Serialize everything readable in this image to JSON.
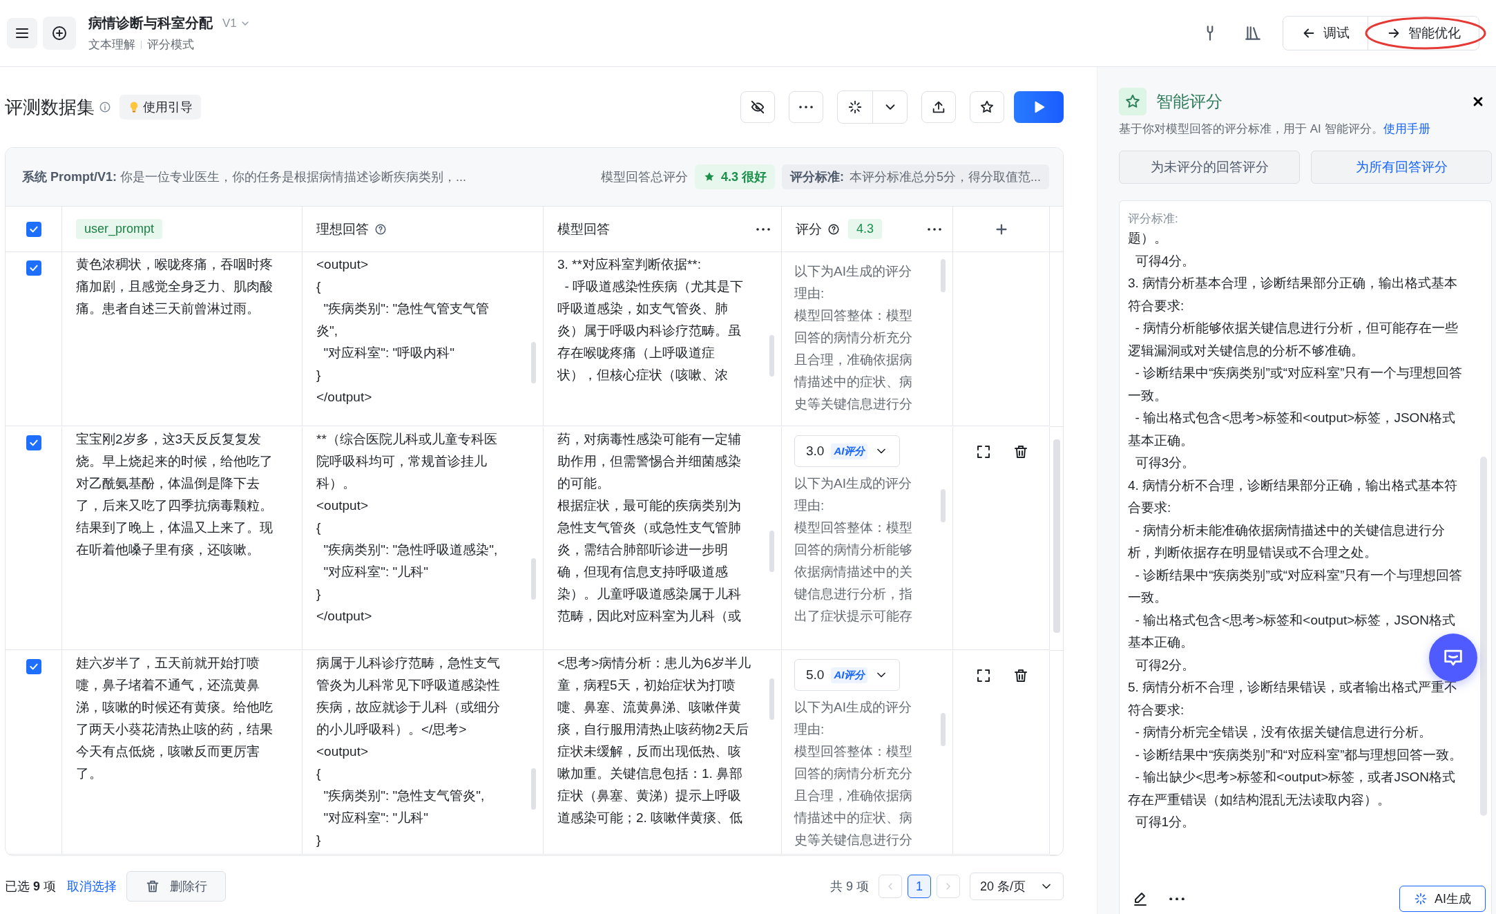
{
  "header": {
    "title": "病情诊断与科室分配",
    "version": "V1",
    "breadcrumb": [
      "文本理解",
      "评分模式"
    ],
    "buttons": [
      {
        "label": "调试",
        "kind": "back",
        "highlighted": false
      },
      {
        "label": "智能优化",
        "kind": "forward",
        "highlighted": true
      }
    ]
  },
  "toolbar": {
    "title": "评测数据集",
    "guide": "使用引导"
  },
  "prompt_bar": {
    "label": "系统 Prompt/V1:",
    "text": "你是一位专业医生，你的任务是根据病情描述诊断疾病类别，...",
    "total_label": "模型回答总评分",
    "total_score": "4.3 很好",
    "criteria_label": "评分标准:",
    "criteria_text": "本评分标准总分5分，得分取值范..."
  },
  "table": {
    "all_checked": true,
    "columns": [
      {
        "label": "user_prompt",
        "kind": "tag"
      },
      {
        "label": "理想回答",
        "kind": "help"
      },
      {
        "label": "模型回答",
        "kind": "more"
      },
      {
        "label": "评分",
        "kind": "score",
        "badge": "4.3"
      }
    ],
    "rows": [
      {
        "checked": true,
        "user_prompt": "黄色浓稠状，喉咙疼痛，吞咽时疼痛加剧，且感觉全身乏力、肌肉酸痛。患者自述三天前曾淋过雨。",
        "ideal": [
          "<output>",
          "{",
          "  \"疾病类别\": \"急性气管支气管炎\",",
          "  \"对应科室\": \"呼吸内科\"",
          "}",
          "</output>"
        ],
        "model": [
          "3. **对应科室判断依据**:",
          "  - 呼吸道感染性疾病（尤其是下呼吸道感染，如支气管炎、肺炎）属于呼吸内科诊疗范畴。虽存在喉咙疼痛（上呼吸道症状），但核心症状（咳嗽、浓"
        ],
        "reason": [
          "以下为AI生成的评分理由:",
          "模型回答整体：模型回答的病情分析充分且合理，准确依据病情描述中的症状、病史等关键信息进行分"
        ],
        "actions": false
      },
      {
        "checked": true,
        "user_prompt": "宝宝刚2岁多，这3天反反复复发烧。早上烧起来的时候，给他吃了对乙酰氨基酚，体温倒是降下去了，后来又吃了四季抗病毒颗粒。结果到了晚上，体温又上来了。现在听着他嗓子里有痰，还咳嗽。",
        "ideal": [
          "**（综合医院儿科或儿童专科医院呼吸科均可，常规首诊挂儿科）。",
          "<output>",
          "{",
          "  \"疾病类别\": \"急性呼吸道感染\",",
          "  \"对应科室\": \"儿科\"",
          "}",
          "</output>"
        ],
        "model": [
          "药，对病毒性感染可能有一定辅助作用，但需警惕合并细菌感染的可能。",
          "根据症状，最可能的疾病类别为急性支气管炎（或急性支气管肺炎，需结合肺部听诊进一步明确，但现有信息支持呼吸道感染）。儿童呼吸道感染属于儿科范畴，因此对应科室为儿科（或"
        ],
        "score": "3.0",
        "score_tag": "AI评分",
        "reason": [
          "以下为AI生成的评分理由:",
          "模型回答整体：模型回答的病情分析能够依据病情描述中的关键信息进行分析，指出了症状提示可能存"
        ],
        "actions": true
      },
      {
        "checked": true,
        "user_prompt": "娃六岁半了，五天前就开始打喷嚏，鼻子堵着不通气，还流黄鼻涕，咳嗽的时候还有黄痰。给他吃了两天小葵花清热止咳的药，结果今天有点低烧，咳嗽反而更厉害了。",
        "ideal": [
          "病属于儿科诊疗范畴，急性支气管炎为儿科常见下呼吸道感染性疾病，故应就诊于儿科（或细分的小儿呼吸科）。</思考>",
          "<output>",
          "{",
          "  \"疾病类别\": \"急性支气管炎\",",
          "  \"对应科室\": \"儿科\"",
          "}"
        ],
        "model": [
          "<思考>病情分析：患儿为6岁半儿童，病程5天，初始症状为打喷嚏、鼻塞、流黄鼻涕、咳嗽伴黄痰，自行服用清热止咳药物2天后症状未缓解，反而出现低热、咳嗽加重。关键信息包括：1. 鼻部症状（鼻塞、黄涕）提示上呼吸道感染可能；2. 咳嗽伴黄痰、低"
        ],
        "score": "5.0",
        "score_tag": "AI评分",
        "reason": [
          "以下为AI生成的评分理由:",
          "模型回答整体：模型回答的病情分析充分且合理，准确依据病情描述中的症状、病史等关键信息进行分"
        ],
        "actions": true
      }
    ]
  },
  "footer": {
    "selection": "已选 **9** 项",
    "clear": "取消选择",
    "delete": "删除行",
    "total": "共 9 项",
    "pages": [
      {
        "label": "1",
        "selected": true
      }
    ],
    "page_size": "20 条/页"
  },
  "panel": {
    "title": "智能评分",
    "description": "基于你对模型回答的评分标准，用于 AI 智能评分。",
    "manual_link": "使用手册",
    "buttons": [
      {
        "label": "为未评分的回答评分",
        "primary": false
      },
      {
        "label": "为所有回答评分",
        "primary": true
      }
    ],
    "criteria_label": "评分标准:",
    "criteria": [
      "题）。",
      "  可得4分。",
      "3. 病情分析基本合理，诊断结果部分正确，输出格式基本符合要求:",
      "  - 病情分析能够依据关键信息进行分析，但可能存在一些逻辑漏洞或对关键信息的分析不够准确。",
      "  - 诊断结果中“疾病类别”或“对应科室”只有一个与理想回答一致。",
      "  - 输出格式包含<思考>标签和<output>标签，JSON格式基本正确。",
      "  可得3分。",
      "4. 病情分析不合理，诊断结果部分正确，输出格式基本符合要求:",
      "  - 病情分析未能准确依据病情描述中的关键信息进行分析，判断依据存在明显错误或不合理之处。",
      "  - 诊断结果中“疾病类别”或“对应科室”只有一个与理想回答一致。",
      "  - 输出格式包含<思考>标签和<output>标签，JSON格式基本正确。",
      "  可得2分。",
      "5. 病情分析不合理，诊断结果错误，或者输出格式严重不符合要求:",
      "  - 病情分析完全错误，没有依据关键信息进行分析。",
      "  - 诊断结果中“疾病类别”和“对应科室”都与理想回答一致。",
      "  - 输出缺少<思考>标签和<output>标签，或者JSON格式存在严重错误（如结构混乱无法读取内容）。",
      "  可得1分。"
    ],
    "ai_button": "AI生成"
  }
}
